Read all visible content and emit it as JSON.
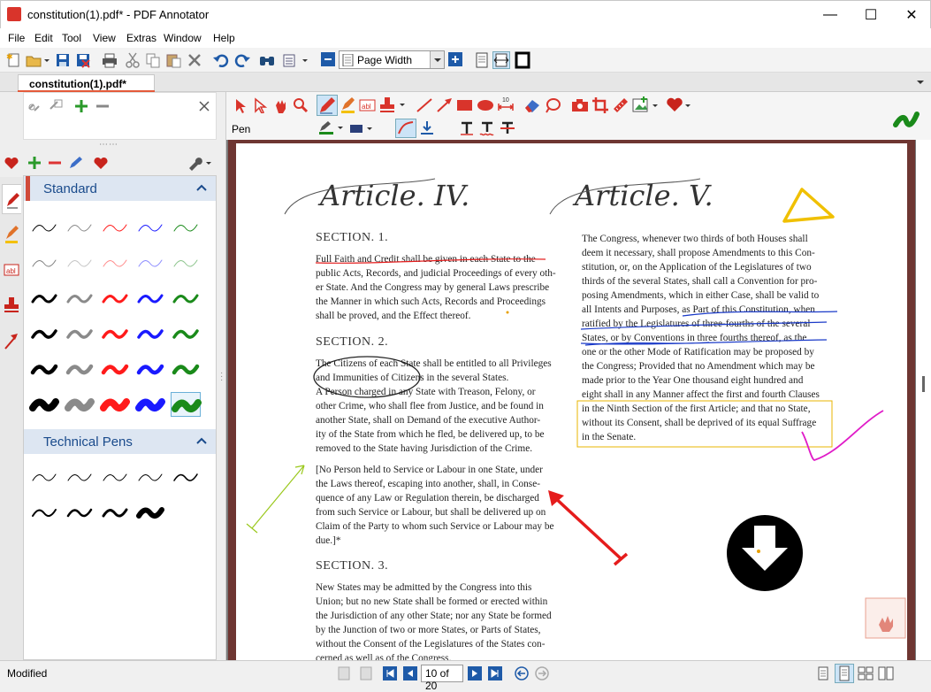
{
  "window": {
    "title": "constitution(1).pdf* - PDF Annotator",
    "controls": {
      "minimize": "—",
      "maximize": "☐",
      "close": "✕"
    }
  },
  "menu": [
    "File",
    "Edit",
    "Tool",
    "View",
    "Extras",
    "Window",
    "Help"
  ],
  "toolbar": {
    "zoom_value": "Page Width"
  },
  "tab": {
    "label": "constitution(1).pdf*"
  },
  "pen_panel": {
    "sections": [
      {
        "label": "Standard"
      },
      {
        "label": "Technical Pens"
      }
    ]
  },
  "anno_toolbar": {
    "tool_label": "Pen"
  },
  "document": {
    "article_left": "Article. IV.",
    "article_right": "Article. V.",
    "section1_title": "SECTION. 1.",
    "section1_lines": [
      "Full Faith and Credit shall be given in each State to the",
      "public Acts, Records, and judicial Proceedings of every oth-",
      "er State. And the Congress may by general Laws prescribe",
      "the Manner in which such Acts, Records and Proceedings",
      "shall be proved, and the Effect thereof."
    ],
    "section2_title": "SECTION. 2.",
    "section2_lines": [
      "The Citizens of each State shall be entitled to all Privileges",
      "and Immunities of Citizens in the several States.",
      "A Person charged in any State with Treason, Felony, or",
      "other Crime, who shall flee from Justice, and be found in",
      "another State, shall on Demand of the executive Author-",
      "ity of the State from which he fled, be delivered up, to be",
      "removed to the State having Jurisdiction of the Crime."
    ],
    "section2b_lines": [
      "[No Person held to Service or Labour in one State, under",
      "the Laws thereof, escaping into another, shall, in Conse-",
      "quence of any Law or Regulation therein, be discharged",
      "from such Service or Labour, but shall be delivered up on",
      "Claim of the Party to whom such Service or Labour may be",
      "due.]*"
    ],
    "section3_title": "SECTION. 3.",
    "section3_lines": [
      "New States may be admitted by the Congress into this",
      "Union; but no new State shall be formed or erected within",
      "the Jurisdiction of any other State; nor any State be formed",
      "by the Junction of two or more States, or Parts of States,",
      "without the Consent of the Legislatures of the States con-",
      "cerned as well as of the Congress."
    ],
    "article5_lines": [
      "The Congress, whenever two thirds of both Houses shall",
      "deem it necessary, shall propose Amendments to this Con-",
      "stitution, or, on the Application of the Legislatures of two",
      "thirds of the several States, shall call a Convention for pro-",
      "posing Amendments, which in either Case, shall be valid to",
      "all Intents and Purposes, as Part of this Constitution, when",
      "ratified by the Legislatures of three-fourths of the several",
      "States, or by Conventions in three fourths thereof, as the",
      "one or the other Mode of Ratification may be proposed by",
      "the Congress; Provided that no Amendment which may be",
      "made prior to the Year One thousand eight hundred and",
      "eight shall in any Manner affect the first and fourth Clauses",
      "in the Ninth Section of the first Article; and that no State,",
      "without its Consent, shall be deprived of its equal Suffrage",
      "in the Senate."
    ]
  },
  "status": {
    "text": "Modified",
    "page_indicator": "10 of 20"
  },
  "colors": {
    "accent_red": "#d9342b",
    "pen_red": "#ff1a1a",
    "pen_blue": "#1a1aff",
    "pen_green": "#1a8a1a",
    "header_blue": "#1a4b8c"
  }
}
